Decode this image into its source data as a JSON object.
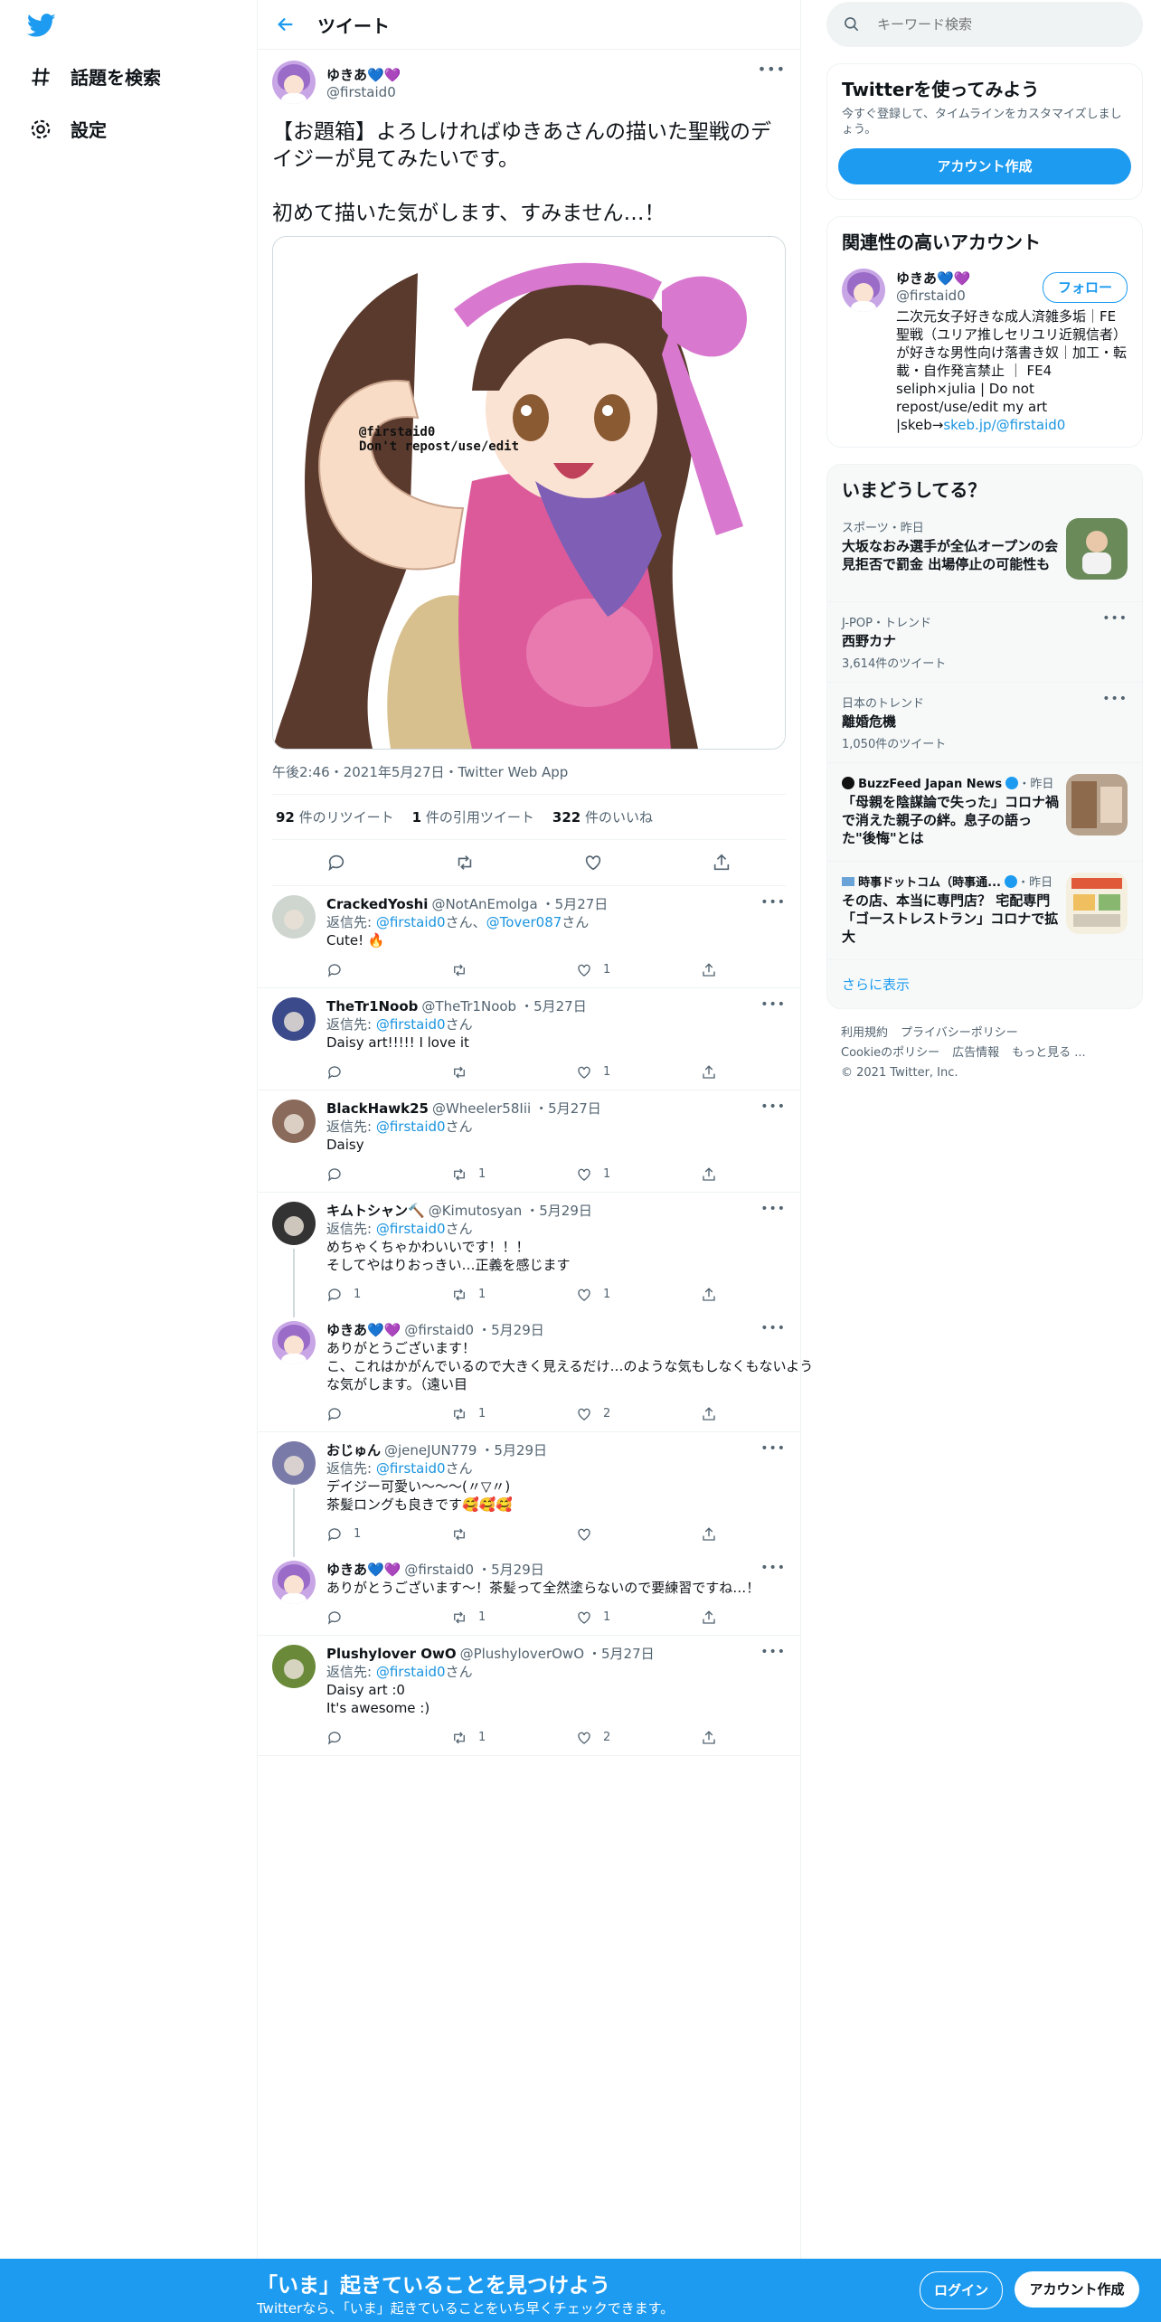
{
  "colors": {
    "accent": "#1d9bf0",
    "text": "#0f1419",
    "secondary": "#536471",
    "border": "#eff3f4"
  },
  "nav": {
    "explore_label": "話題を検索",
    "settings_label": "設定"
  },
  "header": {
    "title": "ツイート"
  },
  "main_tweet": {
    "name": "ゆきあ💙💜",
    "handle": "@firstaid0",
    "text": "【お題箱】よろしければゆきあさんの描いた聖戦のデイジーが見てみたいです。\n\n初めて描いた気がします、すみません…！",
    "watermark_line1": "@firstaid0",
    "watermark_line2": "Don't repost/use/edit",
    "timestamp": "午後2:46・2021年5月27日・Twitter Web App",
    "retweets_count": "92",
    "retweets_label": "件のリツイート",
    "quotes_count": "1",
    "quotes_label": "件の引用ツイート",
    "likes_count": "322",
    "likes_label": "件のいいね"
  },
  "replies": [
    {
      "name": "CrackedYoshi",
      "handle": "@NotAnEmolga",
      "date": "・5月27日",
      "to_prefix": "返信先: ",
      "to": "@firstaid0",
      "to_suffix": "さん、",
      "to2": "@Tover087",
      "to2_suffix": "さん",
      "text": "Cute! 🔥",
      "reply_count": "",
      "rt_count": "",
      "like_count": "1"
    },
    {
      "name": "TheTr1Noob",
      "handle": "@TheTr1Noob",
      "date": "・5月27日",
      "to_prefix": "返信先: ",
      "to": "@firstaid0",
      "to_suffix": "さん",
      "text": "Daisy art!!!!! I love it",
      "reply_count": "",
      "rt_count": "",
      "like_count": "1"
    },
    {
      "name": "BlackHawk25",
      "handle": "@Wheeler58Iii",
      "date": "・5月27日",
      "to_prefix": "返信先: ",
      "to": "@firstaid0",
      "to_suffix": "さん",
      "text": "Daisy",
      "reply_count": "",
      "rt_count": "1",
      "like_count": "1"
    },
    {
      "name": "キムトシャン🔨",
      "handle": "@Kimutosyan",
      "date": "・5月29日",
      "to_prefix": "返信先: ",
      "to": "@firstaid0",
      "to_suffix": "さん",
      "text": "めちゃくちゃかわいいです！！！\nそしてやはりおっきい…正義を感じます",
      "reply_count": "1",
      "rt_count": "1",
      "like_count": "1"
    },
    {
      "name": "ゆきあ💙💜",
      "handle": "@firstaid0",
      "date": "・5月29日",
      "text": "ありがとうございます！\nこ、これはかがんでいるので大きく見えるだけ…のような気もしなくもないような気がします。（遠い目",
      "reply_count": "",
      "rt_count": "1",
      "like_count": "2"
    },
    {
      "name": "おじゅん",
      "handle": "@jeneJUN779",
      "date": "・5月29日",
      "to_prefix": "返信先: ",
      "to": "@firstaid0",
      "to_suffix": "さん",
      "text": "デイジー可愛い〜〜〜(〃▽〃)\n茶髪ロングも良きです🥰🥰🥰",
      "reply_count": "1",
      "rt_count": "",
      "like_count": ""
    },
    {
      "name": "ゆきあ💙💜",
      "handle": "@firstaid0",
      "date": "・5月29日",
      "text": "ありがとうございます～！茶髪って全然塗らないので要練習ですね…！",
      "reply_count": "",
      "rt_count": "1",
      "like_count": "1"
    },
    {
      "name": "Plushylover OwO",
      "handle": "@PlushyloverOwO",
      "date": "・5月27日",
      "to_prefix": "返信先: ",
      "to": "@firstaid0",
      "to_suffix": "さん",
      "text": "Daisy art :0\nIt's awesome :)",
      "reply_count": "",
      "rt_count": "1",
      "like_count": "2"
    }
  ],
  "search": {
    "placeholder": "キーワード検索"
  },
  "signup_card": {
    "title": "Twitterを使ってみよう",
    "subtitle": "今すぐ登録して、タイムラインをカスタマイズしましょう。",
    "button": "アカウント作成"
  },
  "related": {
    "title": "関連性の高いアカウント",
    "name": "ゆきあ💙💜",
    "handle": "@firstaid0",
    "follow": "フォロー",
    "bio": "二次元女子好きな成人済雑多垢｜FE聖戦（ユリア推しセリユリ近親信者）が好きな男性向け落書き奴｜加工・転載・自作発言禁止 ｜ FE4 seliph×julia | Do not repost/use/edit my art |skeb→",
    "bio_link": "skeb.jp/@firstaid0"
  },
  "trends": {
    "title": "いまどうしてる？",
    "items": [
      {
        "category": "スポーツ・昨日",
        "title": "大坂なおみ選手が全仏オープンの会見拒否で罰金 出場停止の可能性も",
        "count": ""
      },
      {
        "category": "J-POP・トレンド",
        "title": "西野カナ",
        "count": "3,614件のツイート"
      },
      {
        "category": "日本のトレンド",
        "title": "離婚危機",
        "count": "1,050件のツイート"
      },
      {
        "category": "BuzzFeed Japan News",
        "category_suffix": "・昨日",
        "title": "「母親を陰謀論で失った」コロナ禍で消えた親子の絆。息子の語った\"後悔\"とは",
        "count": ""
      },
      {
        "category": "時事ドットコム（時事通...",
        "category_suffix": "・昨日",
        "title": "その店、本当に専門店？ 宅配専門「ゴーストレストラン」コロナで拡大",
        "count": ""
      }
    ],
    "more": "さらに表示"
  },
  "footer": {
    "links": [
      "利用規約",
      "プライバシーポリシー",
      "Cookieのポリシー",
      "広告情報",
      "もっと見る ..."
    ],
    "copyright": "© 2021 Twitter, Inc."
  },
  "bottom_bar": {
    "title": "「いま」起きていることを見つけよう",
    "subtitle": "Twitterなら、「いま」起きていることをいち早くチェックできます。",
    "login": "ログイン",
    "signup": "アカウント作成"
  }
}
